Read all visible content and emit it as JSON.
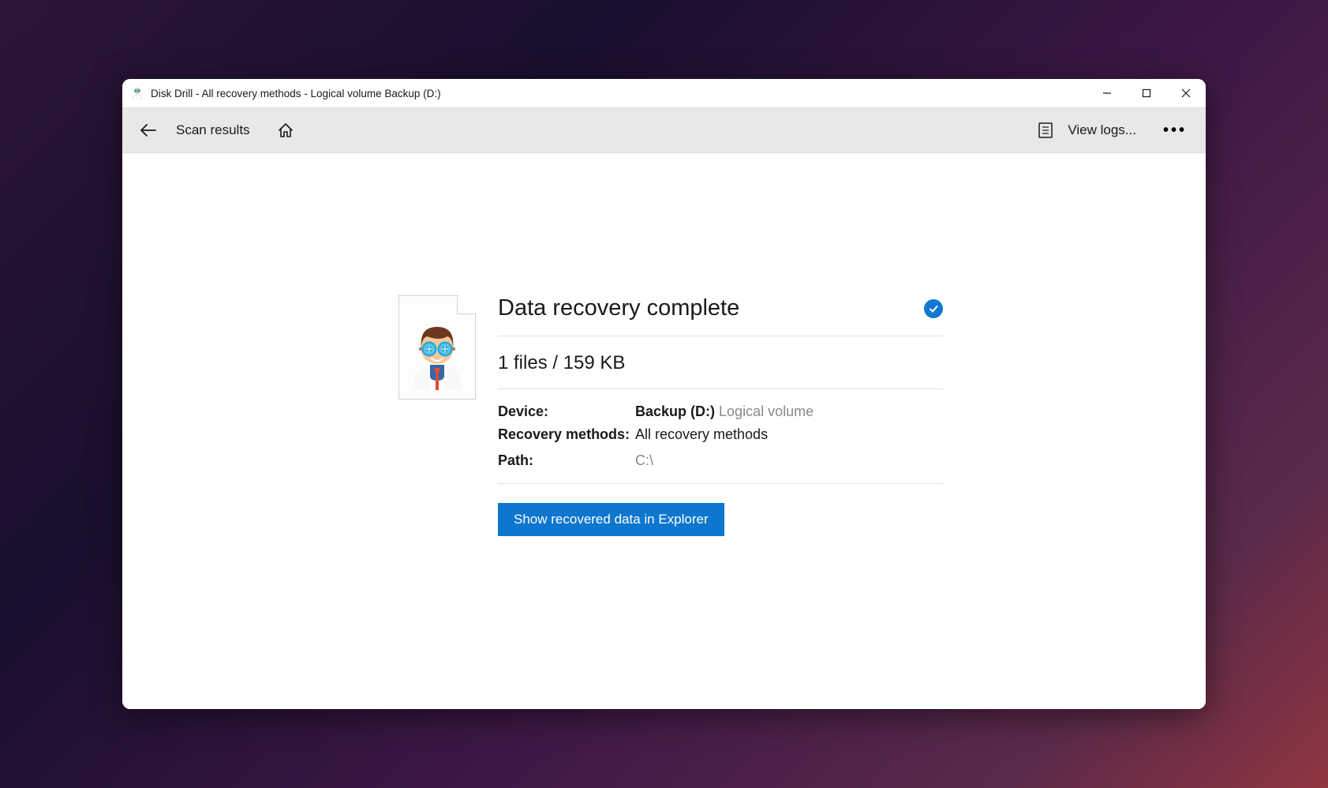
{
  "window": {
    "title": "Disk Drill - All recovery methods - Logical volume Backup (D:)"
  },
  "toolbar": {
    "back_label": "Scan results",
    "view_logs_label": "View logs..."
  },
  "result": {
    "title": "Data recovery complete",
    "summary": "1 files / 159 KB",
    "device_label": "Device:",
    "device_name": "Backup (D:)",
    "device_type": "Logical volume",
    "methods_label": "Recovery methods:",
    "methods_value": "All recovery methods",
    "path_label": "Path:",
    "path_value": "C:\\",
    "action_button_label": "Show recovered data in Explorer"
  }
}
